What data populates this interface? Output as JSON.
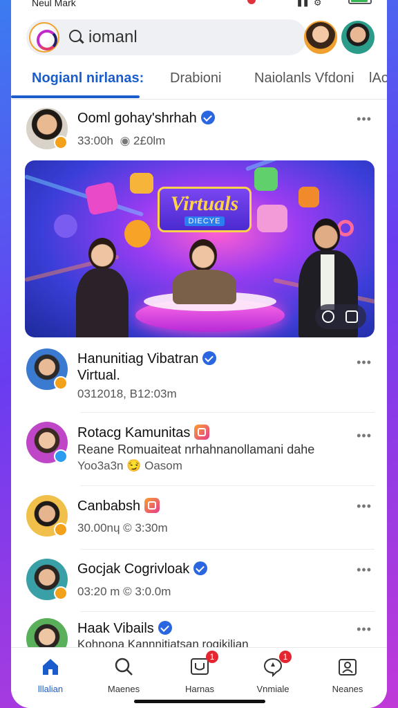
{
  "status": {
    "carrier": "Neul Mark"
  },
  "search": {
    "query": "iomanl"
  },
  "tabs": [
    {
      "label": "Nogianl nirlanas:",
      "active": true
    },
    {
      "label": "Drabioni",
      "active": false
    },
    {
      "label": "Naiolanls Vfdoni",
      "active": false
    },
    {
      "label": "lAo",
      "active": false
    }
  ],
  "featured": {
    "name": "Ooml gohay'shrhah",
    "time": "33:00h",
    "stat": "2£0lm",
    "hero": {
      "title": "Virtuals",
      "subtitle": "DIECYE"
    }
  },
  "posts": [
    {
      "name": "Hanunitiag Vibatran",
      "line2": "Virtual.",
      "meta": "0312018, B12:03m",
      "badge": "verified"
    },
    {
      "name": "Rotacg Kamunitas",
      "line2": "Reane Romuaiteat nrhahnanollamani dahe",
      "meta": "Yoo3a3n 😏 Oasom",
      "badge": "ig"
    },
    {
      "name": "Canbabsh",
      "meta": "30.00nɥ © 3:30m",
      "badge": "ig"
    },
    {
      "name": "Gocjak Cogrivloak",
      "meta": "03:20 m © 3:0.0m",
      "badge": "verified"
    },
    {
      "name": "Haak Vibails",
      "line2": "Kohnona Kannnitiatsan rogikilian",
      "badge": "verified"
    }
  ],
  "nav": [
    {
      "label": "lllalian",
      "icon": "home-icon",
      "active": true
    },
    {
      "label": "Maenes",
      "icon": "search-icon",
      "active": false
    },
    {
      "label": "Harnas",
      "icon": "inbox-icon",
      "active": false,
      "badge": "1"
    },
    {
      "label": "Vnmiale",
      "icon": "chat-icon",
      "active": false,
      "badge": "1"
    },
    {
      "label": "Neanes",
      "icon": "profile-icon",
      "active": false
    }
  ],
  "colors": {
    "accent": "#1a5ccc",
    "verified": "#2a66e0",
    "badge": "#e3262f"
  }
}
